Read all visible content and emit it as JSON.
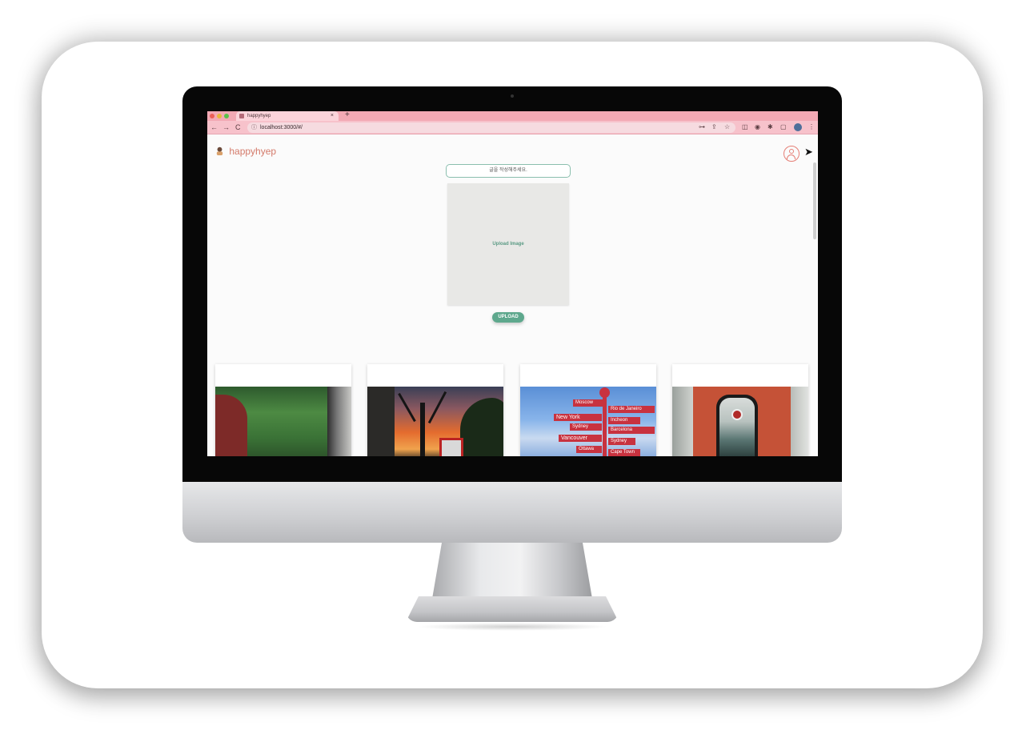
{
  "browser": {
    "tab_title": "happyhyep",
    "tab_close": "×",
    "tab_add": "+",
    "url": "localhost:3000/#/",
    "nav": {
      "back": "←",
      "forward": "→",
      "reload": "C",
      "info": "ⓘ"
    },
    "toolbar_icons": [
      "⊶",
      "⇪",
      "☆",
      "◫",
      "◉",
      "✱",
      "▢",
      "⋮"
    ]
  },
  "app": {
    "logo_text": "happyhyep",
    "post_input_placeholder": "글을 작성해주세요.",
    "upload_area_label": "Upload Image",
    "upload_button_label": "UPLOAD"
  },
  "gallery": {
    "cards": [
      {
        "name": "forest-window"
      },
      {
        "name": "sunset-tree"
      },
      {
        "name": "sign-post",
        "signs": [
          "Moscow",
          "Rio de Janeiro",
          "New York",
          "Incheon",
          "Barcelona",
          "Vancouver",
          "Sydney",
          "Ottawa",
          "Cape Town"
        ]
      },
      {
        "name": "train-door"
      }
    ]
  },
  "colors": {
    "tab_bar": "#f3a9b4",
    "accent_green": "#5ea88d",
    "logo": "#d47a6a"
  }
}
